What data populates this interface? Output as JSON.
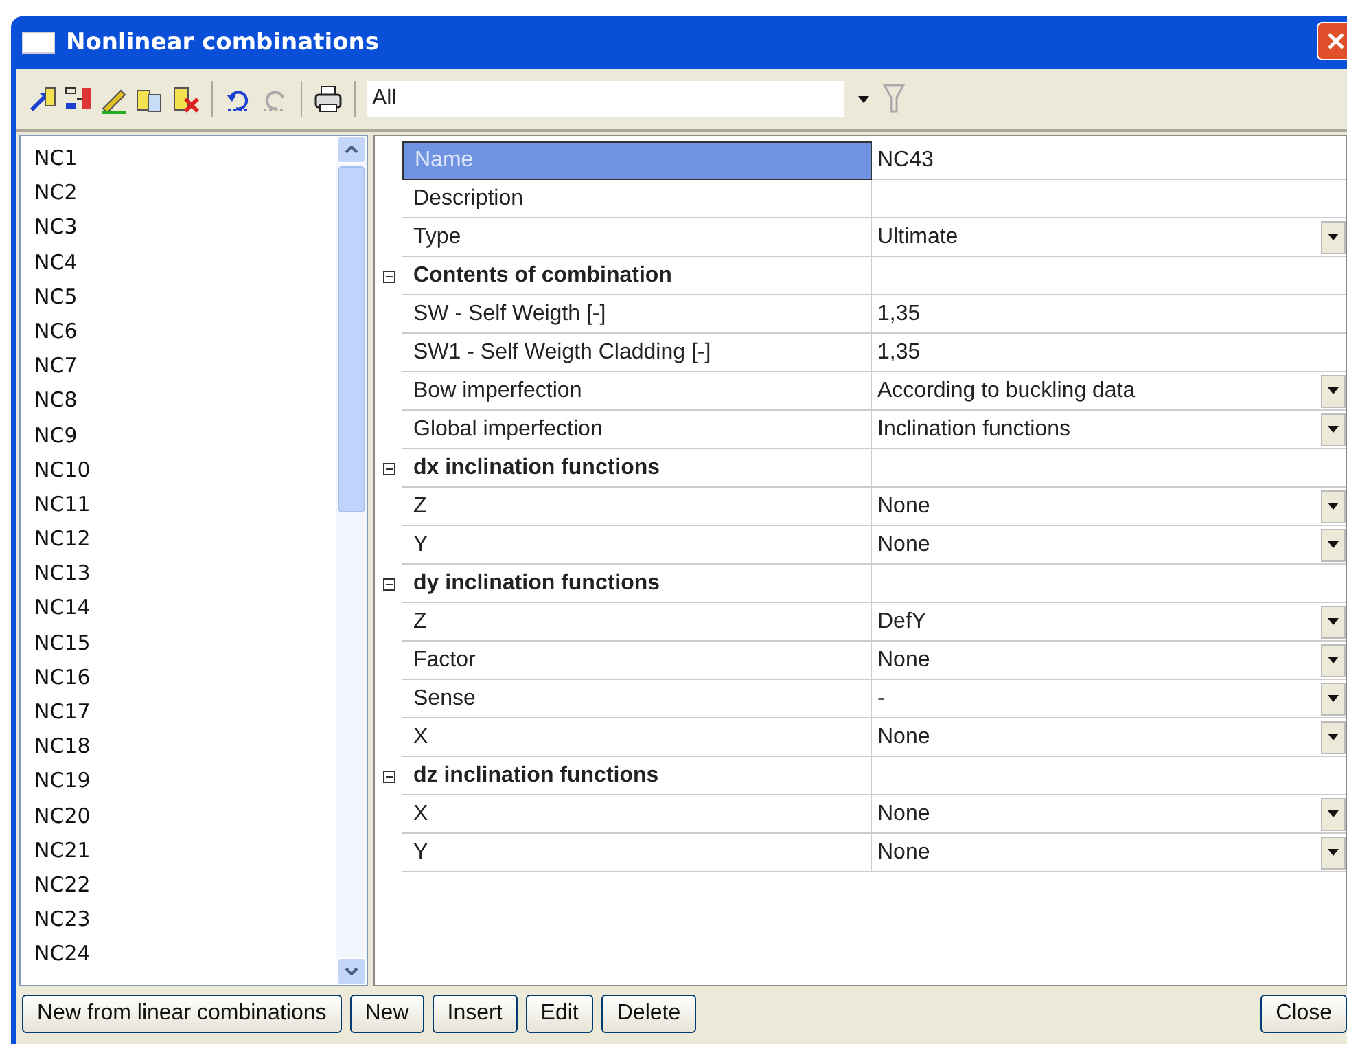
{
  "window": {
    "title": "Nonlinear combinations"
  },
  "toolbar": {
    "filter": {
      "value": "All"
    }
  },
  "list": {
    "items": [
      {
        "label": "NC1"
      },
      {
        "label": "NC2"
      },
      {
        "label": "NC3"
      },
      {
        "label": "NC4"
      },
      {
        "label": "NC5"
      },
      {
        "label": "NC6"
      },
      {
        "label": "NC7"
      },
      {
        "label": "NC8"
      },
      {
        "label": "NC9"
      },
      {
        "label": "NC10"
      },
      {
        "label": "NC11"
      },
      {
        "label": "NC12"
      },
      {
        "label": "NC13"
      },
      {
        "label": "NC14"
      },
      {
        "label": "NC15"
      },
      {
        "label": "NC16"
      },
      {
        "label": "NC17"
      },
      {
        "label": "NC18"
      },
      {
        "label": "NC19"
      },
      {
        "label": "NC20"
      },
      {
        "label": "NC21"
      },
      {
        "label": "NC22"
      },
      {
        "label": "NC23"
      },
      {
        "label": "NC24"
      }
    ]
  },
  "properties": [
    {
      "kind": "field",
      "name": "Name",
      "value": "NC43",
      "dropdown": false,
      "selected": true
    },
    {
      "kind": "field",
      "name": "Description",
      "dropdown": false,
      "selected": false
    },
    {
      "kind": "field",
      "name": "Type",
      "value": "Ultimate",
      "dropdown": true,
      "selected": false
    },
    {
      "kind": "group",
      "name": "Contents of combination",
      "expanded": true
    },
    {
      "kind": "field",
      "name": "SW - Self Weigth [-]",
      "value": "1,35",
      "dropdown": false,
      "selected": false
    },
    {
      "kind": "field",
      "name": "SW1 - Self Weigth Cladding [-]",
      "value": "1,35",
      "dropdown": false,
      "selected": false
    },
    {
      "kind": "field",
      "name": "Bow imperfection",
      "value": "According to buckling data",
      "dropdown": true,
      "selected": false
    },
    {
      "kind": "field",
      "name": "Global imperfection",
      "value": "Inclination functions",
      "dropdown": true,
      "selected": false
    },
    {
      "kind": "group",
      "name": "dx inclination functions",
      "expanded": true
    },
    {
      "kind": "field",
      "name": "Z",
      "value": "None",
      "dropdown": true,
      "selected": false
    },
    {
      "kind": "field",
      "name": "Y",
      "value": "None",
      "dropdown": true,
      "selected": false
    },
    {
      "kind": "group",
      "name": "dy inclination functions",
      "expanded": true
    },
    {
      "kind": "field",
      "name": "Z",
      "value": "DefY",
      "dropdown": true,
      "selected": false
    },
    {
      "kind": "field",
      "name": "Factor",
      "value": "None",
      "dropdown": true,
      "selected": false
    },
    {
      "kind": "field",
      "name": "Sense",
      "value": "-",
      "dropdown": true,
      "selected": false
    },
    {
      "kind": "field",
      "name": "X",
      "value": "None",
      "dropdown": true,
      "selected": false
    },
    {
      "kind": "group",
      "name": "dz inclination functions",
      "expanded": true
    },
    {
      "kind": "field",
      "name": "X",
      "value": "None",
      "dropdown": true,
      "selected": false
    },
    {
      "kind": "field",
      "name": "Y",
      "value": "None",
      "dropdown": true,
      "selected": false
    }
  ],
  "buttons": {
    "left": [
      "New from linear combinations",
      "New",
      "Insert",
      "Edit",
      "Delete"
    ],
    "right": [
      "Close"
    ]
  }
}
